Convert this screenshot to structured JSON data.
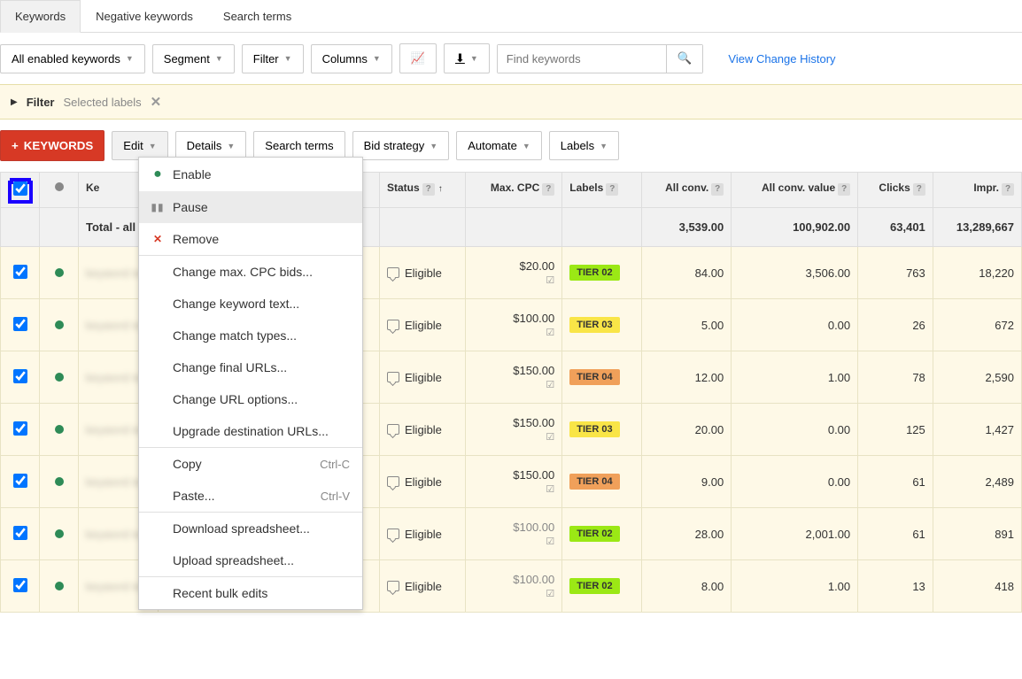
{
  "tabs": [
    {
      "label": "Keywords",
      "active": true
    },
    {
      "label": "Negative keywords",
      "active": false
    },
    {
      "label": "Search terms",
      "active": false
    }
  ],
  "toolbar": {
    "scope": "All enabled keywords",
    "segment": "Segment",
    "filter": "Filter",
    "columns": "Columns",
    "search_placeholder": "Find keywords",
    "history_link": "View Change History"
  },
  "filter_bar": {
    "label": "Filter",
    "selected": "Selected labels"
  },
  "action_bar": {
    "keywords_btn": "KEYWORDS",
    "edit": "Edit",
    "details": "Details",
    "search_terms": "Search terms",
    "bid_strategy": "Bid strategy",
    "automate": "Automate",
    "labels": "Labels"
  },
  "edit_menu": {
    "enable": "Enable",
    "pause": "Pause",
    "remove": "Remove",
    "change_cpc": "Change max. CPC bids...",
    "change_text": "Change keyword text...",
    "change_match": "Change match types...",
    "change_final": "Change final URLs...",
    "change_url_opts": "Change URL options...",
    "upgrade_dest": "Upgrade destination URLs...",
    "copy": "Copy",
    "copy_sc": "Ctrl-C",
    "paste": "Paste...",
    "paste_sc": "Ctrl-V",
    "download": "Download spreadsheet...",
    "upload": "Upload spreadsheet...",
    "recent": "Recent bulk edits"
  },
  "columns": {
    "status_col": "Status",
    "max_cpc": "Max. CPC",
    "labels": "Labels",
    "all_conv": "All conv.",
    "all_conv_value": "All conv. value",
    "clicks": "Clicks",
    "impr": "Impr."
  },
  "totals": {
    "label": "Total - all",
    "all_conv": "3,539.00",
    "all_conv_value": "100,902.00",
    "clicks": "63,401",
    "impr": "13,289,667"
  },
  "rows": [
    {
      "status": "Eligible",
      "cpc": "$20.00",
      "tier": "TIER 02",
      "tier_cls": "tier02",
      "all_conv": "84.00",
      "all_conv_value": "3,506.00",
      "clicks": "763",
      "impr": "18,220",
      "grey": false
    },
    {
      "status": "Eligible",
      "cpc": "$100.00",
      "tier": "TIER 03",
      "tier_cls": "tier03",
      "all_conv": "5.00",
      "all_conv_value": "0.00",
      "clicks": "26",
      "impr": "672",
      "grey": false
    },
    {
      "status": "Eligible",
      "cpc": "$150.00",
      "tier": "TIER 04",
      "tier_cls": "tier04",
      "all_conv": "12.00",
      "all_conv_value": "1.00",
      "clicks": "78",
      "impr": "2,590",
      "grey": false
    },
    {
      "status": "Eligible",
      "cpc": "$150.00",
      "tier": "TIER 03",
      "tier_cls": "tier03",
      "all_conv": "20.00",
      "all_conv_value": "0.00",
      "clicks": "125",
      "impr": "1,427",
      "grey": false
    },
    {
      "status": "Eligible",
      "cpc": "$150.00",
      "tier": "TIER 04",
      "tier_cls": "tier04",
      "all_conv": "9.00",
      "all_conv_value": "0.00",
      "clicks": "61",
      "impr": "2,489",
      "grey": false
    },
    {
      "status": "Eligible",
      "cpc": "$100.00",
      "tier": "TIER 02",
      "tier_cls": "tier02",
      "all_conv": "28.00",
      "all_conv_value": "2,001.00",
      "clicks": "61",
      "impr": "891",
      "grey": true
    },
    {
      "status": "Eligible",
      "cpc": "$100.00",
      "tier": "TIER 02",
      "tier_cls": "tier02",
      "all_conv": "8.00",
      "all_conv_value": "1.00",
      "clicks": "13",
      "impr": "418",
      "grey": true
    }
  ]
}
